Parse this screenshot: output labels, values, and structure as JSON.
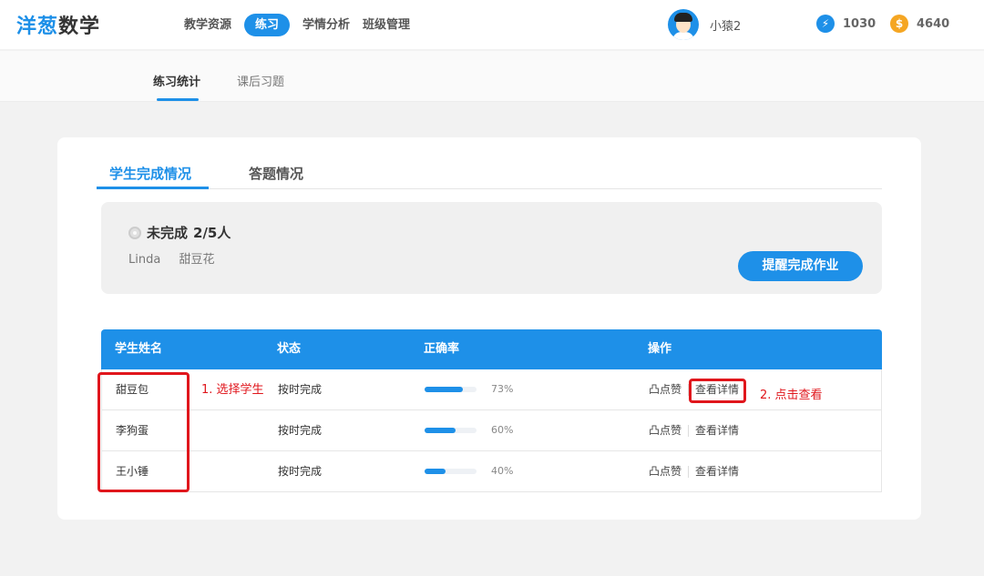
{
  "header": {
    "logo_part1": "洋葱",
    "logo_part2": "数学",
    "nav": [
      "教学资源",
      "练习",
      "学情分析",
      "班级管理"
    ],
    "active_nav": "练习",
    "username": "小猿2",
    "energy": "1030",
    "coins": "4640",
    "energy_icon_glyph": "⚡",
    "coin_icon_glyph": "$",
    "energy_color": "#1e90e8",
    "coin_color": "#f5a623"
  },
  "subnav": {
    "tabs": [
      "练习统计",
      "课后习题"
    ],
    "active": "练习统计"
  },
  "card": {
    "tabs": [
      "学生完成情况",
      "答题情况"
    ],
    "active_tab": "学生完成情况",
    "summary": {
      "status_label": "未完成",
      "status_count": "2/5人",
      "names": [
        "Linda",
        "甜豆花"
      ],
      "remind_button": "提醒完成作业"
    },
    "table": {
      "headers": [
        "学生姓名",
        "状态",
        "正确率",
        "操作"
      ],
      "rows": [
        {
          "name": "甜豆包",
          "status": "按时完成",
          "accuracy": 0.73,
          "accuracy_text": "73%",
          "like": "凸点赞",
          "detail": "查看详情"
        },
        {
          "name": "李狗蛋",
          "status": "按时完成",
          "accuracy": 0.6,
          "accuracy_text": "60%",
          "like": "凸点赞",
          "detail": "查看详情"
        },
        {
          "name": "王小锤",
          "status": "按时完成",
          "accuracy": 0.4,
          "accuracy_text": "40%",
          "like": "凸点赞",
          "detail": "查看详情"
        }
      ]
    }
  },
  "annotations": {
    "step1": "1. 选择学生",
    "step2": "2. 点击查看",
    "color": "#e0161c"
  }
}
